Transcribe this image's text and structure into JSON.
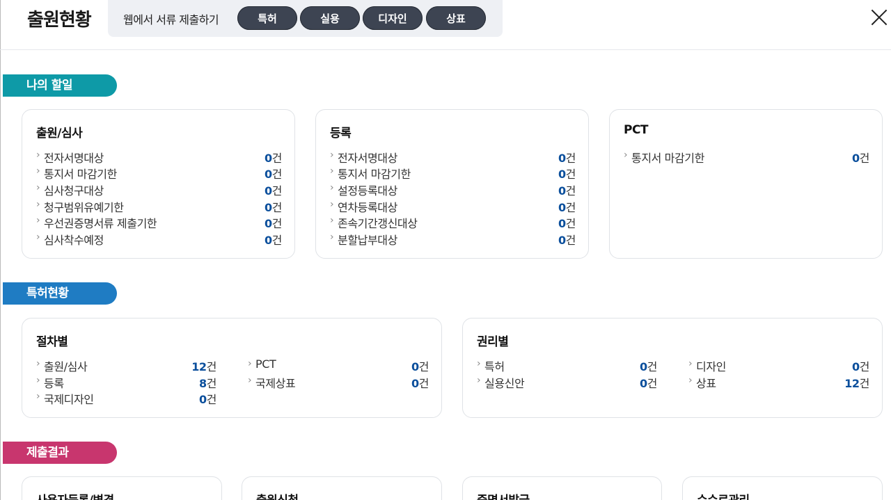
{
  "header": {
    "title": "출원현황",
    "web_submit_label": "웹에서 서류 제출하기",
    "pills": [
      "특허",
      "실용",
      "디자인",
      "상표"
    ]
  },
  "sections": {
    "todo": "나의 할일",
    "patent_status": "특허현황",
    "submit_result": "제출결과"
  },
  "unit": "건",
  "todo_cards": [
    {
      "title": "출원/심사",
      "items": [
        {
          "label": "전자서명대상",
          "count": "0"
        },
        {
          "label": "통지서 마감기한",
          "count": "0"
        },
        {
          "label": "심사청구대상",
          "count": "0"
        },
        {
          "label": "청구범위유예기한",
          "count": "0"
        },
        {
          "label": "우선권증명서류 제출기한",
          "count": "0"
        },
        {
          "label": "심사착수예정",
          "count": "0"
        }
      ]
    },
    {
      "title": "등록",
      "items": [
        {
          "label": "전자서명대상",
          "count": "0"
        },
        {
          "label": "통지서 마감기한",
          "count": "0"
        },
        {
          "label": "설정등록대상",
          "count": "0"
        },
        {
          "label": "연차등록대상",
          "count": "0"
        },
        {
          "label": "존속기간갱신대상",
          "count": "0"
        },
        {
          "label": "분할납부대상",
          "count": "0"
        }
      ]
    },
    {
      "title": "PCT",
      "items": [
        {
          "label": "통지서 마감기한",
          "count": "0"
        }
      ]
    }
  ],
  "procedure_card": {
    "title": "절차별",
    "items": [
      {
        "label": "출원/심사",
        "count": "12"
      },
      {
        "label": "등록",
        "count": "8"
      },
      {
        "label": "국제디자인",
        "count": "0"
      },
      {
        "label": "PCT",
        "count": "0"
      },
      {
        "label": "국제상표",
        "count": "0"
      }
    ]
  },
  "right_card": {
    "title": "권리별",
    "items": [
      {
        "label": "특허",
        "count": "0"
      },
      {
        "label": "실용신안",
        "count": "0"
      },
      {
        "label": "디자인",
        "count": "0"
      },
      {
        "label": "상표",
        "count": "12"
      }
    ]
  },
  "result_cards": [
    "사용자등록/변경",
    "출원신청",
    "증명서발급",
    "수수료관리"
  ]
}
